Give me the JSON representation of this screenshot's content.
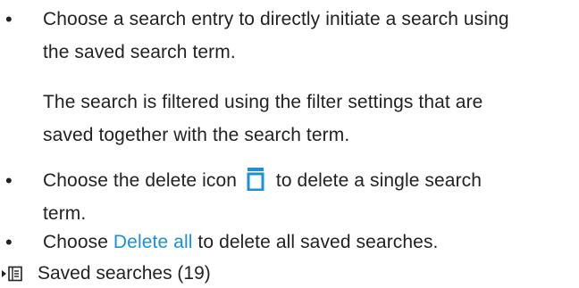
{
  "list": {
    "item1": {
      "line1": "Choose a search entry to directly initiate a search using",
      "line2": "the saved search term.",
      "sub_line1": "The search is filtered using the filter settings that are",
      "sub_line2": "saved together with the search term."
    },
    "item2": {
      "prefix": "Choose the delete icon",
      "suffix": "to delete a single search",
      "line2": "term.",
      "icon": "trash-icon",
      "icon_color": "#1a91d9"
    },
    "item3": {
      "prefix": "Choose",
      "link": "Delete all",
      "suffix": "to delete all saved searches.",
      "link_color": "#1a91d9"
    },
    "bullet": "•"
  },
  "footer": {
    "label": "Saved searches (19)",
    "icon": "expand-list-icon"
  }
}
